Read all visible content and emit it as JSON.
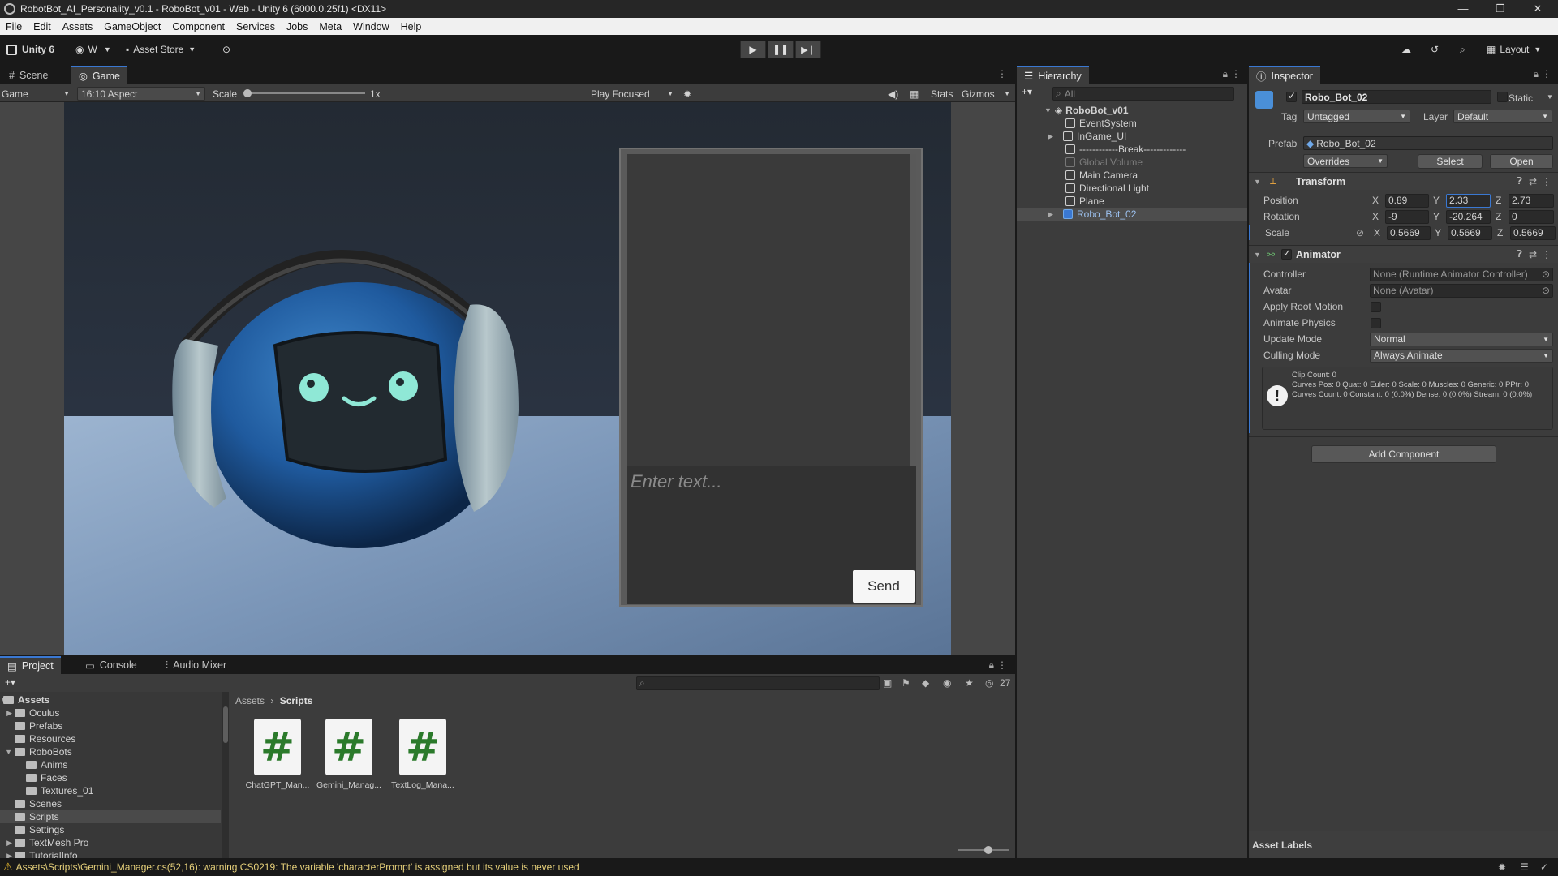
{
  "window": {
    "title": "RobotBot_AI_Personality_v0.1 - RoboBot_v01 - Web - Unity 6 (6000.0.25f1) <DX11>"
  },
  "menu": [
    "File",
    "Edit",
    "Assets",
    "GameObject",
    "Component",
    "Services",
    "Jobs",
    "Meta",
    "Window",
    "Help"
  ],
  "toolbar": {
    "unity_label": "Unity 6",
    "account_label": "W",
    "asset_store_label": "Asset Store",
    "layout_label": "Layout"
  },
  "scene_tabs": {
    "scene": "Scene",
    "game": "Game"
  },
  "gamebar": {
    "display": "Game",
    "aspect": "16:10 Aspect",
    "scale_label": "Scale",
    "scale_value": "1x",
    "play_mode": "Play Focused",
    "stats": "Stats",
    "gizmos": "Gizmos"
  },
  "chat": {
    "placeholder": "Enter text...",
    "send_label": "Send"
  },
  "hierarchy": {
    "tab": "Hierarchy",
    "search_placeholder": "All",
    "scene_name": "RoboBot_v01",
    "items": [
      {
        "label": "EventSystem",
        "dim": false
      },
      {
        "label": "InGame_UI",
        "dim": false
      },
      {
        "label": "------------Break-------------",
        "dim": false
      },
      {
        "label": "Global Volume",
        "dim": true
      },
      {
        "label": "Main Camera",
        "dim": false
      },
      {
        "label": "Directional Light",
        "dim": false
      },
      {
        "label": "Plane",
        "dim": false
      },
      {
        "label": "Robo_Bot_02",
        "dim": false
      }
    ]
  },
  "inspector": {
    "tab": "Inspector",
    "object_name": "Robo_Bot_02",
    "static_label": "Static",
    "tag_label": "Tag",
    "tag_value": "Untagged",
    "layer_label": "Layer",
    "layer_value": "Default",
    "prefab_label": "Prefab",
    "prefab_value": "Robo_Bot_02",
    "overrides_label": "Overrides",
    "select_label": "Select",
    "open_label": "Open",
    "transform": {
      "title": "Transform",
      "position_label": "Position",
      "position": {
        "x": "0.89",
        "y": "2.33",
        "z": "2.73"
      },
      "rotation_label": "Rotation",
      "rotation": {
        "x": "-9",
        "y": "-20.264",
        "z": "0"
      },
      "scale_label": "Scale",
      "scale": {
        "x": "0.5669",
        "y": "0.5669",
        "z": "0.5669"
      }
    },
    "animator": {
      "title": "Animator",
      "controller_label": "Controller",
      "controller_value": "None (Runtime Animator Controller)",
      "avatar_label": "Avatar",
      "avatar_value": "None (Avatar)",
      "apply_root_motion_label": "Apply Root Motion",
      "animate_physics_label": "Animate Physics",
      "update_mode_label": "Update Mode",
      "update_mode_value": "Normal",
      "culling_mode_label": "Culling Mode",
      "culling_mode_value": "Always Animate",
      "info_line1": "Clip Count: 0",
      "info_line2": "Curves Pos: 0 Quat: 0 Euler: 0 Scale: 0 Muscles: 0 Generic: 0 PPtr: 0",
      "info_line3": "Curves Count: 0 Constant: 0 (0.0%) Dense: 0 (0.0%) Stream: 0 (0.0%)"
    },
    "add_component_label": "Add Component",
    "asset_labels": "Asset Labels"
  },
  "project": {
    "tabs": {
      "project": "Project",
      "console": "Console",
      "audio_mixer": "Audio Mixer"
    },
    "hidden_count": "27",
    "breadcrumb_root": "Assets",
    "breadcrumb_current": "Scripts",
    "tree": [
      {
        "label": "Assets",
        "indent": 0,
        "arrow": "▼",
        "bold": true
      },
      {
        "label": "Oculus",
        "indent": 1,
        "arrow": "▶",
        "bold": false
      },
      {
        "label": "Prefabs",
        "indent": 1,
        "arrow": "",
        "bold": false
      },
      {
        "label": "Resources",
        "indent": 1,
        "arrow": "",
        "bold": false
      },
      {
        "label": "RoboBots",
        "indent": 1,
        "arrow": "▼",
        "bold": false
      },
      {
        "label": "Anims",
        "indent": 2,
        "arrow": "",
        "bold": false
      },
      {
        "label": "Faces",
        "indent": 2,
        "arrow": "",
        "bold": false
      },
      {
        "label": "Textures_01",
        "indent": 2,
        "arrow": "",
        "bold": false
      },
      {
        "label": "Scenes",
        "indent": 1,
        "arrow": "",
        "bold": false
      },
      {
        "label": "Scripts",
        "indent": 1,
        "arrow": "",
        "bold": false
      },
      {
        "label": "Settings",
        "indent": 1,
        "arrow": "",
        "bold": false
      },
      {
        "label": "TextMesh Pro",
        "indent": 1,
        "arrow": "▶",
        "bold": false
      },
      {
        "label": "TutorialInfo",
        "indent": 1,
        "arrow": "▶",
        "bold": false
      }
    ],
    "assets": [
      {
        "label": "ChatGPT_Man...",
        "glyph": "#"
      },
      {
        "label": "Gemini_Manag...",
        "glyph": "#"
      },
      {
        "label": "TextLog_Mana...",
        "glyph": "#"
      }
    ]
  },
  "status": {
    "message": "Assets\\Scripts\\Gemini_Manager.cs(52,16): warning CS0219: The variable 'characterPrompt' is assigned but its value is never used"
  },
  "colors": {
    "accent": "#3a78d2",
    "robot_blue": "#1f5a9e",
    "face_glow": "#8fe8d6",
    "warning": "#f0c030"
  }
}
